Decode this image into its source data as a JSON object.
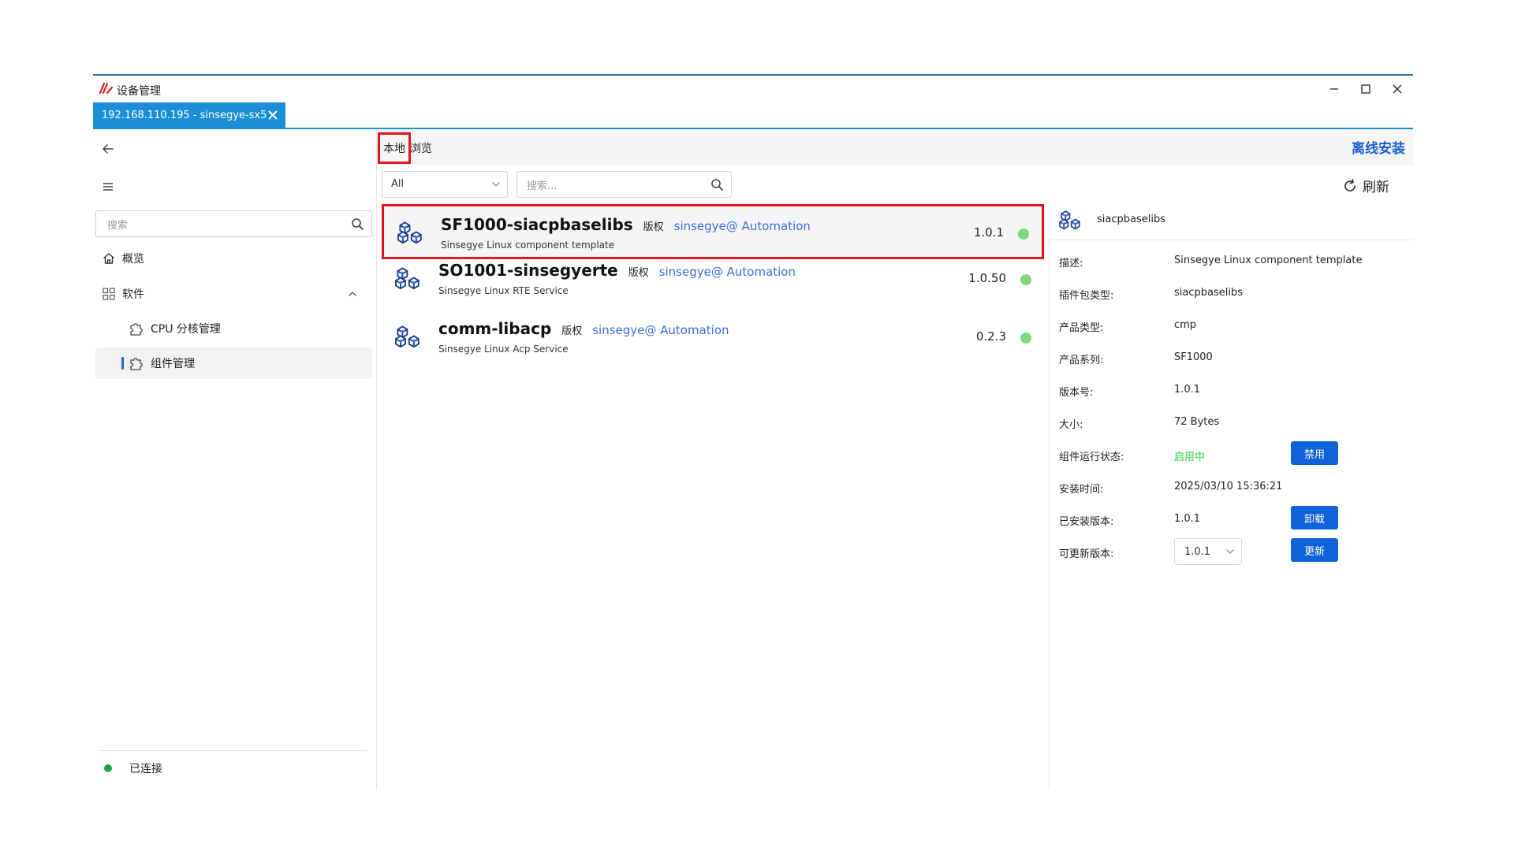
{
  "window": {
    "title": "设备管理"
  },
  "tab": {
    "label": "192.168.110.195 - sinsegye-sx5"
  },
  "sidebar": {
    "search_placeholder": "搜索",
    "items": [
      {
        "label": "概览",
        "icon": "home-icon"
      },
      {
        "label": "软件",
        "icon": "grid-icon",
        "expanded": true
      },
      {
        "label": "CPU 分核管理",
        "icon": "puzzle-icon"
      },
      {
        "label": "组件管理",
        "icon": "puzzle-icon",
        "active": true
      }
    ],
    "status": "已连接"
  },
  "content": {
    "tabs": [
      "本地",
      "浏览"
    ],
    "active_tab": "本地",
    "offline_install": "离线安装",
    "filter_value": "All",
    "search_placeholder": "搜索...",
    "refresh_label": "刷新"
  },
  "packages": [
    {
      "name": "SF1000-siacpbaselibs",
      "copyright": "版权",
      "author": "sinsegye@ Automation",
      "description": "Sinsegye Linux component template",
      "version": "1.0.1",
      "selected": true
    },
    {
      "name": "SO1001-sinsegyerte",
      "copyright": "版权",
      "author": "sinsegye@ Automation",
      "description": "Sinsegye Linux RTE Service",
      "version": "1.0.50"
    },
    {
      "name": "comm-libacp",
      "copyright": "版权",
      "author": "sinsegye@ Automation",
      "description": "Sinsegye Linux Acp Service",
      "version": "0.2.3"
    }
  ],
  "detail": {
    "title": "siacpbaselibs",
    "rows": [
      {
        "label": "描述:",
        "value": "Sinsegye Linux component template"
      },
      {
        "label": "插件包类型:",
        "value": "siacpbaselibs"
      },
      {
        "label": "产品类型:",
        "value": "cmp"
      },
      {
        "label": "产品系列:",
        "value": "SF1000"
      },
      {
        "label": "版本号:",
        "value": "1.0.1"
      },
      {
        "label": "大小:",
        "value": "72 Bytes"
      },
      {
        "label": "组件运行状态:",
        "value": "启用中"
      },
      {
        "label": "安装时间:",
        "value": "2025/03/10 15:36:21"
      },
      {
        "label": "已安装版本:",
        "value": "1.0.1"
      },
      {
        "label": "可更新版本:",
        "value": "1.0.1"
      }
    ],
    "buttons": {
      "disable": "禁用",
      "uninstall": "卸载",
      "update": "更新"
    }
  },
  "colors": {
    "accent": "#1a8fd6",
    "button": "#1062d8",
    "link": "#1a5fd0",
    "highlight": "#e0151f",
    "status_green": "#7cd87c",
    "connected": "#1aa34a"
  }
}
